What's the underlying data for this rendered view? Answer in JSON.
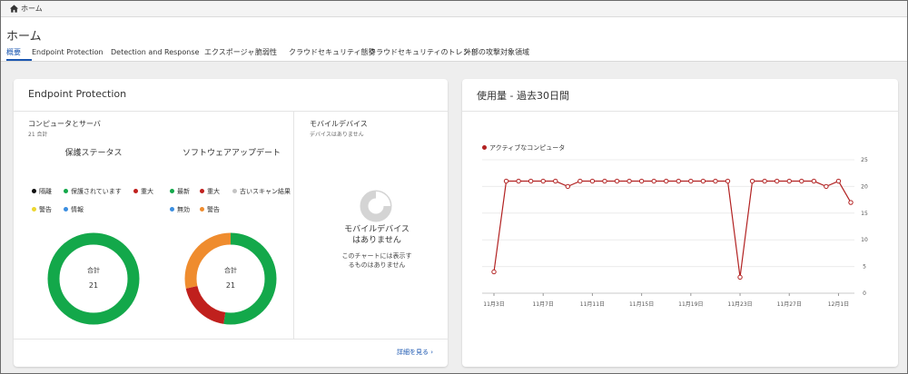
{
  "topbar": {
    "breadcrumb": "ホーム"
  },
  "page": {
    "title": "ホーム",
    "tabs": [
      {
        "label": "概要",
        "active": true
      },
      {
        "label": "Endpoint Protection",
        "active": false
      },
      {
        "label": "Detection and Response",
        "active": false
      },
      {
        "label": "エクスポージャ",
        "active": false
      },
      {
        "label": "脆弱性",
        "active": false
      },
      {
        "label": "クラウドセキュリティ態勢",
        "active": false
      },
      {
        "label": "クラウドセキュリティのトレンド",
        "active": false
      },
      {
        "label": "外部の攻撃対象領域",
        "active": false
      }
    ]
  },
  "endpoint_card": {
    "title": "Endpoint Protection",
    "computers": {
      "title": "コンピュータとサーバ",
      "subtitle": "21 合計",
      "protection": {
        "title": "保護ステータス",
        "legend": [
          {
            "label": "隔離",
            "color": "#111111"
          },
          {
            "label": "保護されています",
            "color": "#13a84a"
          },
          {
            "label": "重大",
            "color": "#c0201d"
          },
          {
            "label": "警告",
            "color": "#ecd630"
          },
          {
            "label": "情報",
            "color": "#3b8ee0"
          }
        ],
        "center_label": "合計",
        "center_value": "21",
        "segments": [
          {
            "name": "保護されています",
            "value": 21,
            "color": "#13a84a"
          }
        ]
      },
      "software": {
        "title": "ソフトウェアアップデート",
        "legend": [
          {
            "label": "最新",
            "color": "#13a84a"
          },
          {
            "label": "重大",
            "color": "#c0201d"
          },
          {
            "label": "古いスキャン結果",
            "color": "#c4c4c4"
          },
          {
            "label": "無効",
            "color": "#3b8ee0"
          },
          {
            "label": "警告",
            "color": "#ef8c2e"
          }
        ],
        "center_label": "合計",
        "center_value": "21",
        "segments": [
          {
            "name": "最新",
            "value": 11,
            "color": "#13a84a"
          },
          {
            "name": "重大",
            "value": 4,
            "color": "#c0201d"
          },
          {
            "name": "警告",
            "value": 6,
            "color": "#ef8c2e"
          }
        ]
      }
    },
    "mobile": {
      "title": "モバイルデバイス",
      "subtitle": "デバイスはありません",
      "empty_title_line1": "モバイルデバイス",
      "empty_title_line2": "はありません",
      "empty_sub_line1": "このチャートには表示す",
      "empty_sub_line2": "るものはありません"
    },
    "more_link": "詳細を見る ›"
  },
  "usage_card": {
    "title": "使用量 - 過去30日間",
    "chart_data": {
      "type": "line",
      "series": [
        {
          "name": "アクティブなコンピュータ",
          "color": "#b22222",
          "x": [
            "11月3日",
            "11月4日",
            "11月5日",
            "11月6日",
            "11月7日",
            "11月8日",
            "11月9日",
            "11月10日",
            "11月11日",
            "11月12日",
            "11月13日",
            "11月14日",
            "11月15日",
            "11月16日",
            "11月17日",
            "11月18日",
            "11月19日",
            "11月20日",
            "11月21日",
            "11月22日",
            "11月23日",
            "11月24日",
            "11月25日",
            "11月26日",
            "11月27日",
            "11月28日",
            "11月29日",
            "11月30日",
            "12月1日",
            "12月2日"
          ],
          "values": [
            4,
            21,
            21,
            21,
            21,
            21,
            20,
            21,
            21,
            21,
            21,
            21,
            21,
            21,
            21,
            21,
            21,
            21,
            21,
            21,
            3,
            21,
            21,
            21,
            21,
            21,
            21,
            20,
            21,
            17
          ]
        }
      ],
      "x_tick_labels": [
        "11月3日",
        "11月7日",
        "11月11日",
        "11月15日",
        "11月19日",
        "11月23日",
        "11月27日",
        "12月1日"
      ],
      "y_ticks": [
        0,
        5,
        10,
        15,
        20,
        25
      ],
      "ylim": [
        0,
        25
      ],
      "y_axis_side": "right",
      "grid": true,
      "legend_position": "top-left"
    }
  }
}
